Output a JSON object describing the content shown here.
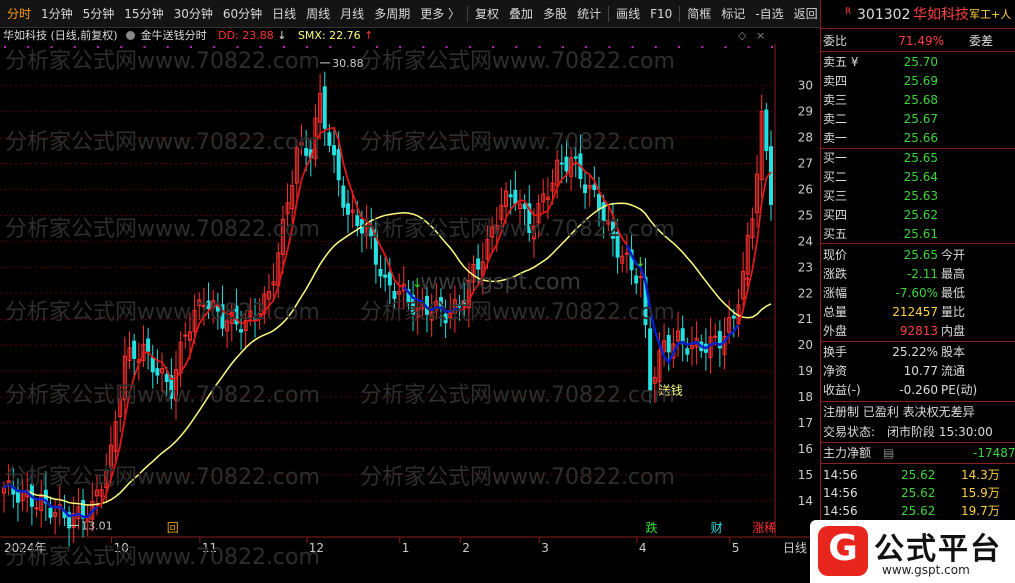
{
  "toolbar": {
    "items": [
      "分时",
      "1分钟",
      "5分钟",
      "15分钟",
      "30分钟",
      "60分钟",
      "日线",
      "周线",
      "月线",
      "多周期",
      "更多 〉",
      "复权",
      "叠加",
      "多股",
      "统计",
      "画线",
      "F10",
      "简框",
      "标记",
      "-自选",
      "返回"
    ]
  },
  "indicator": {
    "name": "华如科技",
    "mode": "(日线,前复权)",
    "formula": "金牛送钱分时",
    "dd_label": "DD: 23.88",
    "smx_label": "SMX: 22.76",
    "dd_arrow": "↓",
    "smx_arrow": "↑"
  },
  "watermarks": [
    "分析家公式网www.70822.com",
    "www.gspt.com"
  ],
  "chart_data": {
    "type": "candlestick",
    "y_ticks": [
      14,
      15,
      16,
      17,
      18,
      19,
      20,
      21,
      22,
      23,
      24,
      25,
      26,
      27,
      28,
      29,
      30
    ],
    "ylim": [
      13.3,
      31.3
    ],
    "x_ticks": [
      {
        "label": "2024年",
        "i": 0
      },
      {
        "label": "10",
        "i": 24
      },
      {
        "label": "11",
        "i": 43
      },
      {
        "label": "12",
        "i": 66
      },
      {
        "label": "1",
        "i": 86
      },
      {
        "label": "2",
        "i": 99
      },
      {
        "label": "3",
        "i": 116
      },
      {
        "label": "4",
        "i": 137
      },
      {
        "label": "5",
        "i": 157
      }
    ],
    "n": 166,
    "annotations": {
      "high": "30.88",
      "low": "13.01",
      "signal": "送钱"
    },
    "bottom_markers": [
      {
        "label": "回",
        "i": 35
      },
      {
        "label": "跌",
        "i": 138
      },
      {
        "label": "财",
        "i": 152
      },
      {
        "label": "涨稀",
        "i": 161
      }
    ],
    "x_axis_label": "日线",
    "colors": {
      "up": "#ff3030",
      "down": "#25e0e0",
      "red_line": "#e01818",
      "yellow_line": "#ffff80",
      "blue_line": "#0020c8",
      "grid": "#5a0000"
    }
  },
  "quote": {
    "code": "301302",
    "name": "华如科技",
    "mark": "R",
    "tag": "军工+人",
    "weibi_label": "委比",
    "weibi": "71.49%",
    "weicha_label": "委差",
    "asks": [
      {
        "label": "卖五 ¥",
        "price": "25.70"
      },
      {
        "label": "卖四",
        "price": "25.69"
      },
      {
        "label": "卖三",
        "price": "25.68"
      },
      {
        "label": "卖二",
        "price": "25.67"
      },
      {
        "label": "卖一",
        "price": "25.66"
      }
    ],
    "bids": [
      {
        "label": "买一",
        "price": "25.65"
      },
      {
        "label": "买二",
        "price": "25.64"
      },
      {
        "label": "买三",
        "price": "25.63"
      },
      {
        "label": "买四",
        "price": "25.62"
      },
      {
        "label": "买五",
        "price": "25.61"
      }
    ],
    "stats": [
      {
        "l1": "现价",
        "v1": "25.65",
        "c1": "dn",
        "l2": "今开"
      },
      {
        "l1": "涨跌",
        "v1": "-2.11",
        "c1": "dn",
        "l2": "最高"
      },
      {
        "l1": "涨幅",
        "v1": "-7.60%",
        "c1": "dn",
        "l2": "最低"
      },
      {
        "l1": "总量",
        "v1": "212457",
        "c1": "yl",
        "l2": "量比"
      },
      {
        "l1": "外盘",
        "v1": "92813",
        "c1": "up",
        "l2": "内盘"
      }
    ],
    "stats2": [
      {
        "l1": "换手",
        "v1": "25.22%",
        "l2": "股本"
      },
      {
        "l1": "净资",
        "v1": "10.77",
        "l2": "流通"
      },
      {
        "l1": "收益(-)",
        "v1": "-0.260",
        "l2": "PE(动)"
      }
    ],
    "info1": "注册制 已盈利 表决权无差异",
    "info2_label": "交易状态:",
    "info2": "闭市阶段 15:30:00",
    "flow_label": "主力净额",
    "flow_value": "-17487",
    "ticks": [
      {
        "time": "14:56",
        "price": "25.62",
        "vol": "14.3万"
      },
      {
        "time": "14:56",
        "price": "25.62",
        "vol": "15.9万"
      },
      {
        "time": "14:56",
        "price": "25.62",
        "vol": "19.7万"
      }
    ]
  },
  "logo": {
    "text": "公式平台",
    "url": "www.gspt.com",
    "letter": "G"
  }
}
